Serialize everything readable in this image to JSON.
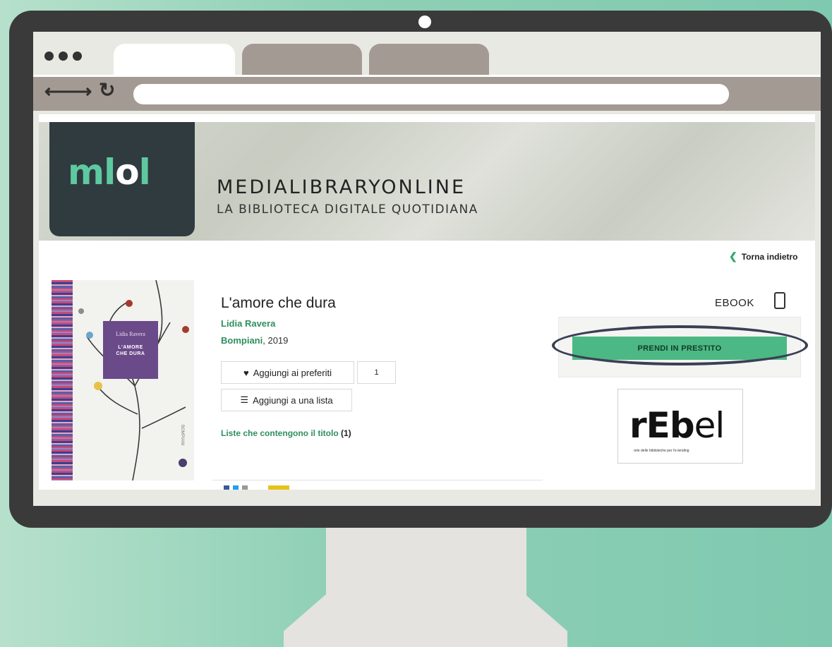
{
  "page": {
    "back_label": "Torna indietro"
  },
  "header": {
    "logo_part1": "ml",
    "logo_part2": "o",
    "logo_part3": "l",
    "brand": "MEDIALIBRARYONLINE",
    "tagline": "LA BIBLIOTECA DIGITALE QUOTIDIANA"
  },
  "book": {
    "title": "L'amore che dura",
    "author": "Lidia Ravera",
    "publisher": "Bompiani",
    "year": ", 2019",
    "cover_author": "Lidia Ravera",
    "cover_title_line1": "L'AMORE",
    "cover_title_line2": "CHE DURA",
    "cover_publisher": "BOMPIANI"
  },
  "actions": {
    "favorite_label": "Aggiungi ai preferiti",
    "favorite_count": "1",
    "list_label": "Aggiungi a una lista",
    "lists_link": "Liste che contengono il titolo",
    "lists_count": " (1)"
  },
  "loan": {
    "format": "EBOOK",
    "button_label": "PRENDI IN PRESTITO"
  },
  "partner": {
    "mark_a": "rEb",
    "mark_b": "el",
    "subtitle": "rete delle biblioteche per l'e-lending"
  },
  "colors": {
    "accent_green": "#4cb884",
    "logo_bg": "#2f3b3f",
    "text_green": "#2e8f5e"
  }
}
